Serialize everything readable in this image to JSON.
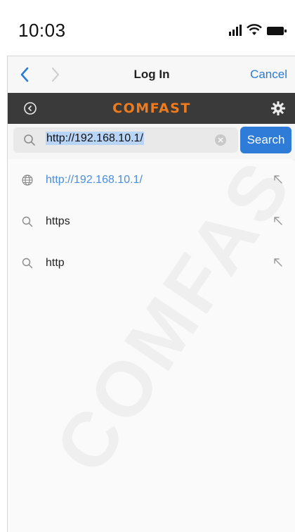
{
  "status_bar": {
    "time": "10:03"
  },
  "nav": {
    "title": "Log In",
    "cancel_label": "Cancel"
  },
  "brand": {
    "logo_text": "COMFAST",
    "logo_color": "#f07b1c"
  },
  "search": {
    "value": "http://192.168.10.1/",
    "button_label": "Search"
  },
  "suggestions": [
    {
      "text": "http://192.168.10.1/",
      "icon": "globe-icon"
    },
    {
      "text": "https",
      "icon": "search-icon"
    },
    {
      "text": "http",
      "icon": "search-icon"
    }
  ],
  "watermark": {
    "text": "COMFAST"
  },
  "colors": {
    "accent": "#2f7cd8",
    "brand_bar": "#3a3a3a"
  }
}
